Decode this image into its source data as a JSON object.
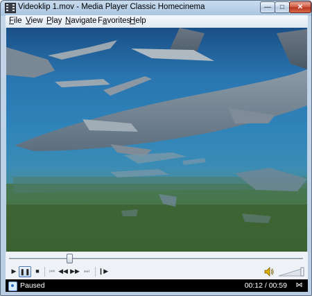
{
  "window": {
    "title": "Videoklip 1.mov - Media Player Classic Homecinema",
    "minimize_glyph": "—",
    "maximize_glyph": "□",
    "close_glyph": "✕"
  },
  "menu": {
    "items": [
      {
        "label": "File",
        "mnemonic": "F",
        "rest": "ile"
      },
      {
        "label": "View",
        "mnemonic": "V",
        "rest": "iew"
      },
      {
        "label": "Play",
        "mnemonic": "P",
        "rest": "lay"
      },
      {
        "label": "Navigate",
        "mnemonic": "N",
        "rest": "avigate"
      },
      {
        "label": "Favorites",
        "pre": "F",
        "mnemonic": "a",
        "rest": "vorites"
      },
      {
        "label": "Help",
        "mnemonic": "H",
        "rest": "elp"
      }
    ]
  },
  "playback": {
    "position_fraction": 0.2,
    "volume_fraction": 1.0
  },
  "controls": {
    "play_glyph": "▶",
    "pause_glyph": "❚❚",
    "stop_glyph": "■",
    "prev_glyph": "⏮",
    "rewind_glyph": "◀◀",
    "forward_glyph": "▶▶",
    "next_glyph": "⏭",
    "frame_step_glyph": "❙▶"
  },
  "status": {
    "state": "Paused",
    "time": "00:12 / 00:59"
  },
  "colors": {
    "status_bg": "#000000",
    "video_water": "#2f84b9",
    "seabed": "#3c6334"
  }
}
